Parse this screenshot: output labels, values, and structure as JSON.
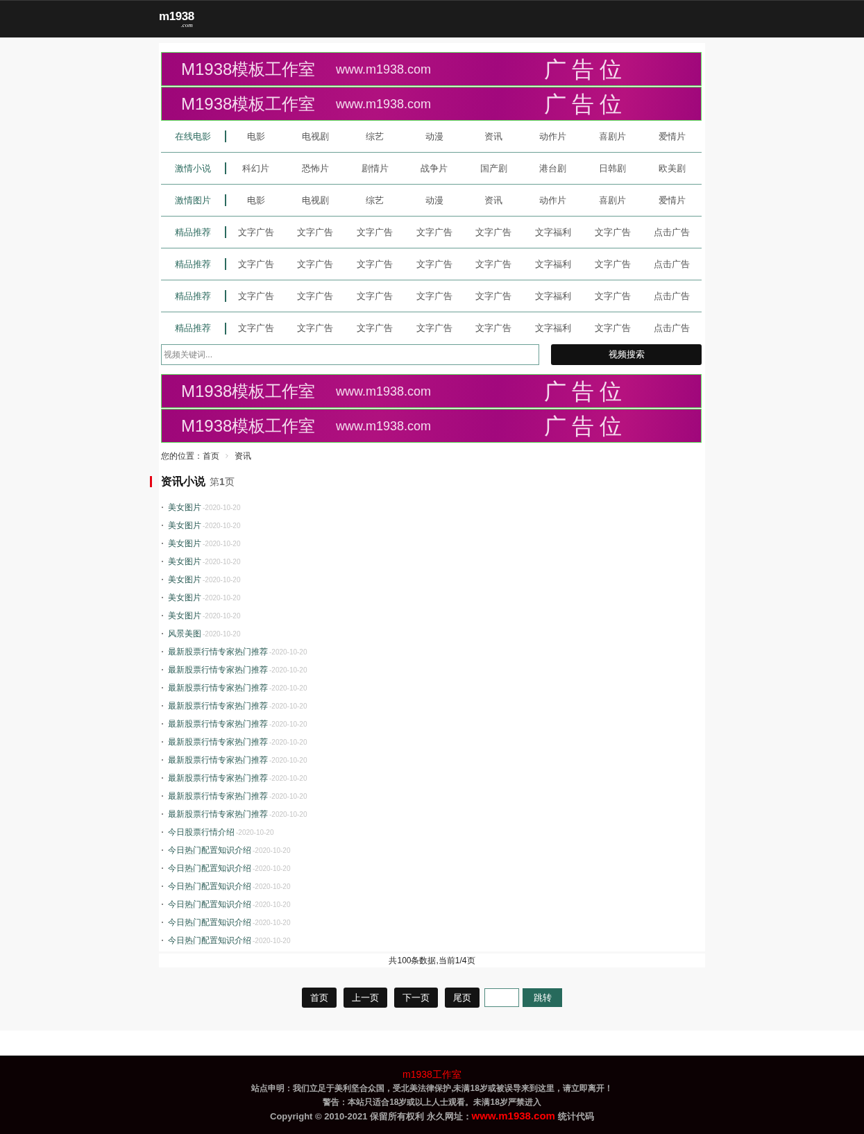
{
  "header": {
    "logo": {
      "name": "m1938",
      "suffix": ".com"
    }
  },
  "top_banners": [
    {
      "brand": "M1938模板工作室",
      "url": "www.m1938.com",
      "label": "广告位"
    },
    {
      "brand": "M1938模板工作室",
      "url": "www.m1938.com",
      "label": "广告位"
    }
  ],
  "nav_rows": [
    {
      "label": "在线电影",
      "links": [
        "电影",
        "电视剧",
        "综艺",
        "动漫",
        "资讯",
        "动作片",
        "喜剧片",
        "爱情片"
      ]
    },
    {
      "label": "激情小说",
      "links": [
        "科幻片",
        "恐怖片",
        "剧情片",
        "战争片",
        "国产剧",
        "港台剧",
        "日韩剧",
        "欧美剧"
      ]
    },
    {
      "label": "激情图片",
      "links": [
        "电影",
        "电视剧",
        "综艺",
        "动漫",
        "资讯",
        "动作片",
        "喜剧片",
        "爱情片"
      ]
    },
    {
      "label": "精品推荐",
      "links": [
        "文字广告",
        "文字广告",
        "文字广告",
        "文字广告",
        "文字广告",
        "文字福利",
        "文字广告",
        "点击广告"
      ]
    },
    {
      "label": "精品推荐",
      "links": [
        "文字广告",
        "文字广告",
        "文字广告",
        "文字广告",
        "文字广告",
        "文字福利",
        "文字广告",
        "点击广告"
      ]
    },
    {
      "label": "精品推荐",
      "links": [
        "文字广告",
        "文字广告",
        "文字广告",
        "文字广告",
        "文字广告",
        "文字福利",
        "文字广告",
        "点击广告"
      ]
    },
    {
      "label": "精品推荐",
      "links": [
        "文字广告",
        "文字广告",
        "文字广告",
        "文字广告",
        "文字广告",
        "文字福利",
        "文字广告",
        "点击广告"
      ]
    }
  ],
  "search": {
    "placeholder": "视频关键词...",
    "button": "视频搜索"
  },
  "mid_banners": [
    {
      "brand": "M1938模板工作室",
      "url": "www.m1938.com",
      "label": "广告位"
    },
    {
      "brand": "M1938模板工作室",
      "url": "www.m1938.com",
      "label": "广告位"
    }
  ],
  "breadcrumb": {
    "prefix": "您的位置：",
    "items": [
      "首页",
      "资讯"
    ]
  },
  "section": {
    "title": "资讯小说",
    "page": "第**1**页"
  },
  "articles": [
    {
      "title": "美女图片",
      "date": "-2020-10-20"
    },
    {
      "title": "美女图片",
      "date": "-2020-10-20"
    },
    {
      "title": "美女图片",
      "date": "-2020-10-20"
    },
    {
      "title": "美女图片",
      "date": "-2020-10-20"
    },
    {
      "title": "美女图片",
      "date": "-2020-10-20"
    },
    {
      "title": "美女图片",
      "date": "-2020-10-20"
    },
    {
      "title": "美女图片",
      "date": "-2020-10-20"
    },
    {
      "title": "风景美图",
      "date": "-2020-10-20"
    },
    {
      "title": "最新股票行情专家热门推荐",
      "date": "-2020-10-20"
    },
    {
      "title": "最新股票行情专家热门推荐",
      "date": "-2020-10-20"
    },
    {
      "title": "最新股票行情专家热门推荐",
      "date": "-2020-10-20"
    },
    {
      "title": "最新股票行情专家热门推荐",
      "date": "-2020-10-20"
    },
    {
      "title": "最新股票行情专家热门推荐",
      "date": "-2020-10-20"
    },
    {
      "title": "最新股票行情专家热门推荐",
      "date": "-2020-10-20"
    },
    {
      "title": "最新股票行情专家热门推荐",
      "date": "-2020-10-20"
    },
    {
      "title": "最新股票行情专家热门推荐",
      "date": "-2020-10-20"
    },
    {
      "title": "最新股票行情专家热门推荐",
      "date": "-2020-10-20"
    },
    {
      "title": "最新股票行情专家热门推荐",
      "date": "-2020-10-20"
    },
    {
      "title": "今日股票行情介绍",
      "date": "-2020-10-20"
    },
    {
      "title": "今日热门配置知识介绍",
      "date": "-2020-10-20"
    },
    {
      "title": "今日热门配置知识介绍",
      "date": "-2020-10-20"
    },
    {
      "title": "今日热门配置知识介绍",
      "date": "-2020-10-20"
    },
    {
      "title": "今日热门配置知识介绍",
      "date": "-2020-10-20"
    },
    {
      "title": "今日热门配置知识介绍",
      "date": "-2020-10-20"
    },
    {
      "title": "今日热门配置知识介绍",
      "date": "-2020-10-20"
    }
  ],
  "stats": "共100条数据,当前1/4页",
  "pagination": {
    "buttons": [
      "首页",
      "上一页",
      "下一页",
      "尾页"
    ],
    "jump_button": "跳转"
  },
  "footer": {
    "title": "m1938工作室",
    "lines": [
      "站点申明：我们立足于美利坚合众国，受北美法律保护,未满18岁或被误导来到这里，请立即离开！",
      "警告：本站只适合18岁或以上人士观看。未满18岁严禁进入"
    ],
    "copyright": {
      "before": "Copyright © 2010-2021 保留所有权利 永久网址：",
      "link": "www.m1938.com",
      "after": "统计代码"
    }
  }
}
